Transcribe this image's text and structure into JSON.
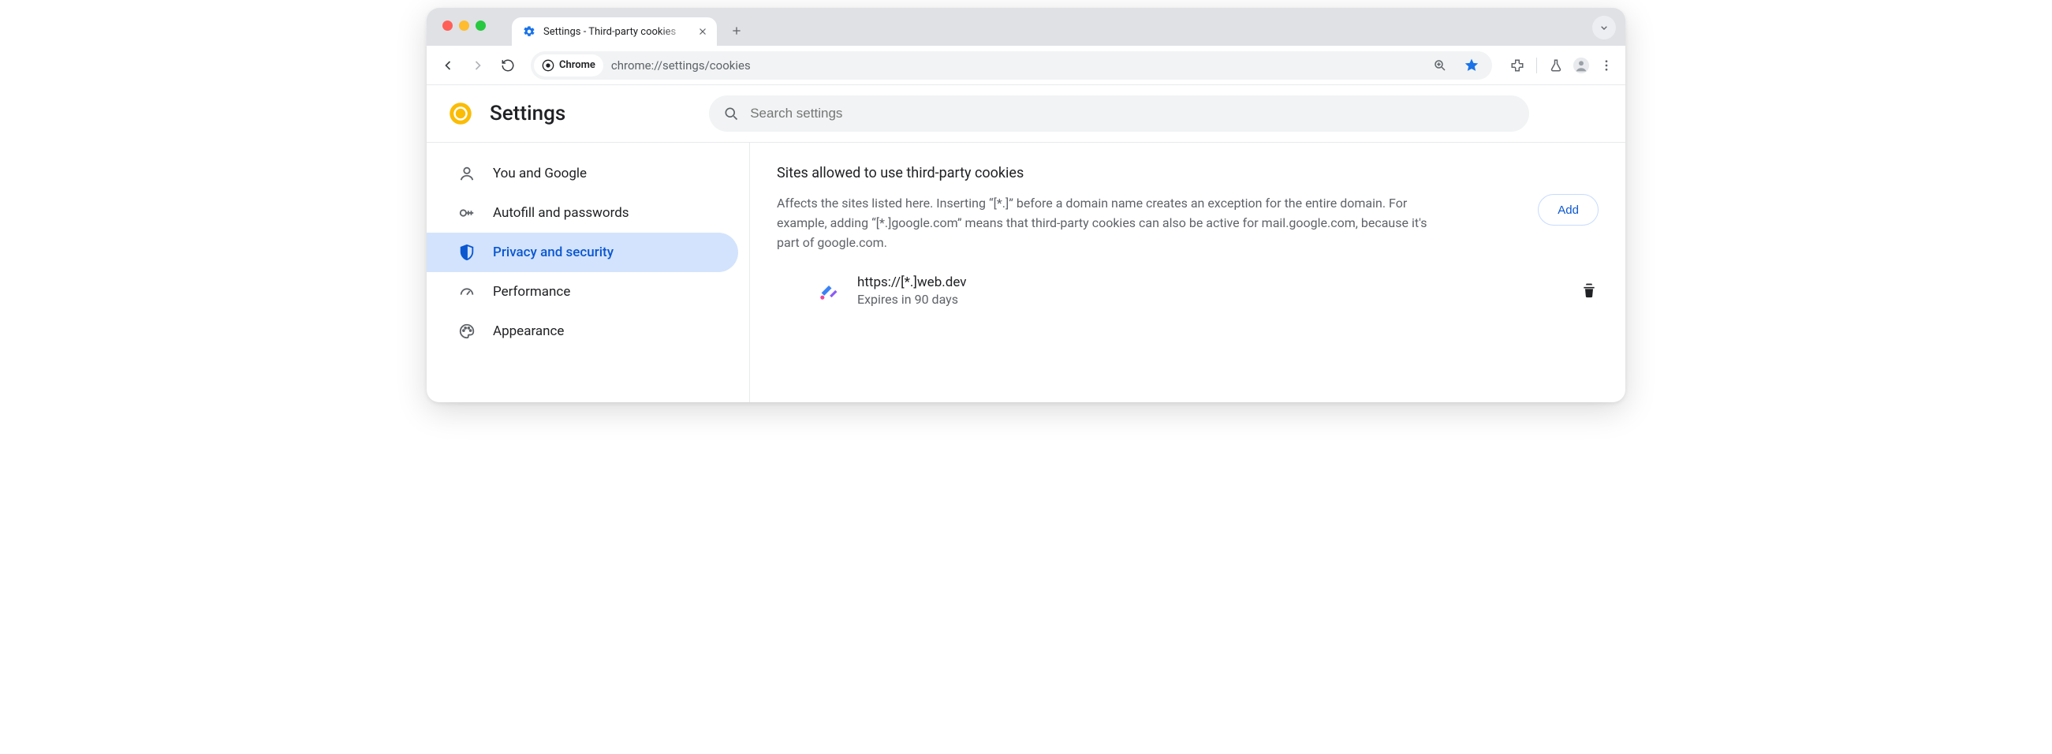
{
  "tabstrip": {
    "tab_title": "Settings - Third-party cookies"
  },
  "toolbar": {
    "site_chip": "Chrome",
    "url": "chrome://settings/cookies"
  },
  "settings_header": {
    "title": "Settings",
    "search_placeholder": "Search settings"
  },
  "sidebar": {
    "items": [
      {
        "label": "You and Google"
      },
      {
        "label": "Autofill and passwords"
      },
      {
        "label": "Privacy and security"
      },
      {
        "label": "Performance"
      },
      {
        "label": "Appearance"
      }
    ],
    "active_index": 2
  },
  "main": {
    "section_heading": "Sites allowed to use third-party cookies",
    "description": "Affects the sites listed here. Inserting “[*.]” before a domain name creates an exception for the entire domain. For example, adding “[*.]google.com” means that third-party cookies can also be active for mail.google.com, because it's part of google.com.",
    "add_label": "Add",
    "entries": [
      {
        "site": "https://[*.]web.dev",
        "expires": "Expires in 90 days"
      }
    ]
  }
}
